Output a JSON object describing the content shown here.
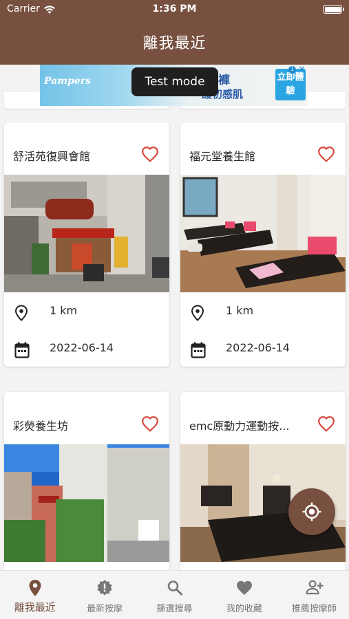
{
  "status_bar": {
    "carrier": "Carrier",
    "time": "1:36 PM"
  },
  "header": {
    "title": "離我最近"
  },
  "ad": {
    "brand": "Pampers",
    "text_line1": "紙尿褲",
    "text_line2": "護初感肌",
    "cta": "立即體驗",
    "toast": "Test mode"
  },
  "colors": {
    "primary": "#77503f",
    "heart": "#d9483b",
    "background": "#f3f3f3"
  },
  "cards": [
    {
      "name": "舒活苑復興會館",
      "distance": "1 km",
      "date": "2022-06-14"
    },
    {
      "name": "福元堂養生館",
      "distance": "1 km",
      "date": "2022-06-14"
    },
    {
      "name": "彩熒養生坊"
    },
    {
      "name": "emc原動力運動按..."
    }
  ],
  "icons": {
    "favorite": "heart-outline-icon",
    "location": "location-pin-icon",
    "date": "calendar-icon",
    "fab": "my-location-icon"
  },
  "bottom_nav": [
    {
      "label": "離我最近",
      "icon": "location-pin-icon",
      "active": true
    },
    {
      "label": "最新按摩",
      "icon": "new-badge-icon",
      "active": false
    },
    {
      "label": "篩選搜尋",
      "icon": "search-icon",
      "active": false
    },
    {
      "label": "我的收藏",
      "icon": "heart-icon",
      "active": false
    },
    {
      "label": "推薦按摩師",
      "icon": "add-person-icon",
      "active": false
    }
  ]
}
